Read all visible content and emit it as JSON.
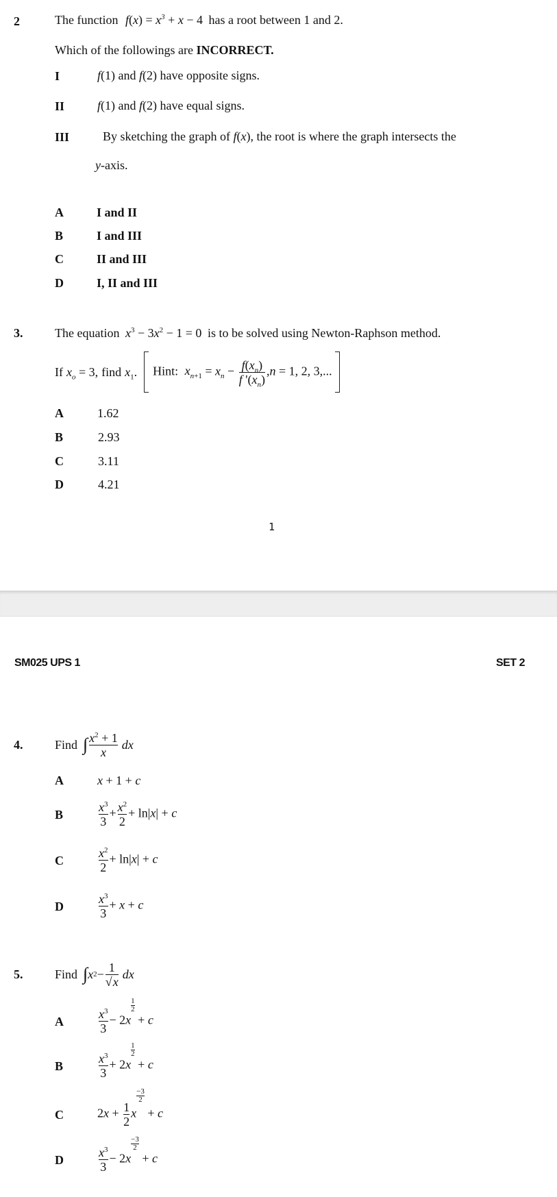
{
  "page1": {
    "q2": {
      "number": "2",
      "stem_prefix": "The function",
      "stem_function": "f(x) = x³ + x − 4",
      "stem_suffix": "has a root between 1 and 2.",
      "instruction_prefix": "Which of the followings are",
      "instruction_emphasis": "INCORRECT.",
      "statements": [
        {
          "label": "I",
          "math": "f(1) and f(2)",
          "text": "have opposite signs."
        },
        {
          "label": "II",
          "math": "f(1) and f(2)",
          "text": "have equal signs."
        },
        {
          "label": "III",
          "prefix": "By sketching the graph of",
          "math": "f(x),",
          "text": "the root is where the graph intersects the",
          "continuation_var": "y",
          "continuation": "-axis."
        }
      ],
      "options": [
        {
          "label": "A",
          "text": "I and II"
        },
        {
          "label": "B",
          "text": "I and III"
        },
        {
          "label": "C",
          "text": "II and III"
        },
        {
          "label": "D",
          "text": "I, II and III"
        }
      ]
    },
    "q3": {
      "number": "3.",
      "stem_prefix": "The equation",
      "stem_equation": "x³ − 3x² − 1 = 0",
      "stem_suffix": "is to be solved using Newton-Raphson method.",
      "given_prefix": "If",
      "given": "xₒ = 3,",
      "find_prefix": "find",
      "find": "x₁.",
      "hint_label": "Hint:",
      "hint_formula": "xₙ₊₁ = xₙ − f(xₙ) / f'(xₙ)",
      "hint_numerator": "f(xₙ)",
      "hint_denominator": "f'(xₙ)",
      "hint_suffix": ", n = 1, 2, 3, ...",
      "options": [
        {
          "label": "A",
          "text": "1.62"
        },
        {
          "label": "B",
          "text": "2.93"
        },
        {
          "label": "C",
          "text": "3.11"
        },
        {
          "label": "D",
          "text": "4.21"
        }
      ]
    },
    "page_number": "1"
  },
  "page2": {
    "header_left": "SM025 UPS 1",
    "header_right": "SET 2",
    "q4": {
      "number": "4.",
      "stem_prefix": "Find",
      "integral": "∫ (x² + 1)/x dx",
      "numerator": "x² + 1",
      "denominator": "x",
      "dx": "dx",
      "options": [
        {
          "label": "A",
          "text": "x + 1 + c"
        },
        {
          "label": "B",
          "text": "x³/3 + x²/2 + ln|x| + c"
        },
        {
          "label": "C",
          "text": "x²/2 + ln|x| + c"
        },
        {
          "label": "D",
          "text": "x³/3 + x + c"
        }
      ]
    },
    "q5": {
      "number": "5.",
      "stem_prefix": "Find",
      "integral": "∫ x² − 1/√x dx",
      "dx": "dx",
      "options": [
        {
          "label": "A",
          "text": "x³/3 − 2x^(1/2) + c"
        },
        {
          "label": "B",
          "text": "x³/3 + 2x^(1/2) + c"
        },
        {
          "label": "C",
          "text": "2x + (1/2)x^(−3/2) + c"
        },
        {
          "label": "D",
          "text": "x³/3 − 2x^(−3/2) + c"
        }
      ]
    }
  },
  "colors": {
    "text": "#111111",
    "page_gap": "#eeeeef",
    "background": "#ffffff"
  }
}
